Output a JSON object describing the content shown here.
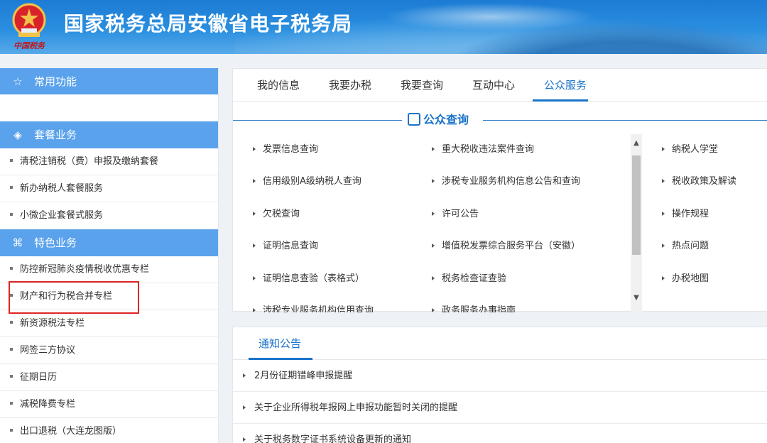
{
  "header": {
    "title": "国家税务总局安徽省电子税务局",
    "emblem_text": "中国税务"
  },
  "sidebar": {
    "sections": [
      {
        "label": "常用功能",
        "icon": "star-icon",
        "items": []
      },
      {
        "label": "套餐业务",
        "icon": "layers-icon",
        "items": [
          "清税注销税（费）申报及缴纳套餐",
          "新办纳税人套餐服务",
          "小微企业套餐式服务"
        ]
      },
      {
        "label": "特色业务",
        "icon": "grid-icon",
        "items": [
          "防控新冠肺炎疫情税收优惠专栏",
          "财产和行为税合并专栏",
          "新资源税法专栏",
          "网签三方协议",
          "征期日历",
          "减税降费专栏",
          "出口退税（大连龙图版）"
        ]
      }
    ],
    "highlighted_item": "财产和行为税合并专栏"
  },
  "tabs": {
    "items": [
      "我的信息",
      "我要办税",
      "我要查询",
      "互动中心",
      "公众服务"
    ],
    "active": "公众服务"
  },
  "public_query": {
    "title": "公众查询",
    "col1": [
      "发票信息查询",
      "信用级别A级纳税人查询",
      "欠税查询",
      "证明信息查询",
      "证明信息查验（表格式）",
      "涉税专业服务机构信用查询"
    ],
    "col2": [
      "重大税收违法案件查询",
      "涉税专业服务机构信息公告和查询",
      "许可公告",
      "增值税发票综合服务平台（安徽）",
      "税务检查证查验",
      "政务服务办事指南"
    ],
    "col3": [
      "纳税人学堂",
      "税收政策及解读",
      "操作规程",
      "热点问题",
      "办税地图"
    ]
  },
  "notices": {
    "tab": "通知公告",
    "items": [
      "2月份征期错峰申报提醒",
      "关于企业所得税年报网上申报功能暂时关闭的提醒",
      "关于税务数字证书系统设备更新的通知"
    ]
  },
  "colors": {
    "accent": "#1a73c9",
    "sidebar_head": "#5aa2ec",
    "highlight_box": "#e02424"
  }
}
